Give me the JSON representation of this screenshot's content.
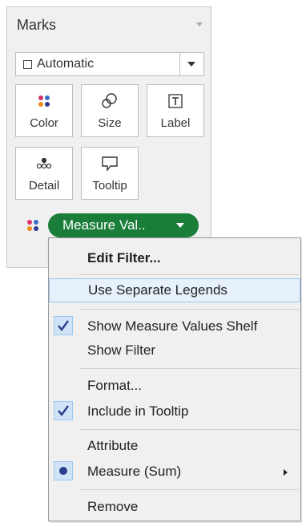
{
  "marks": {
    "title": "Marks",
    "mark_type": "Automatic",
    "tiles": [
      {
        "label": "Color",
        "icon": "color-icon"
      },
      {
        "label": "Size",
        "icon": "size-icon"
      },
      {
        "label": "Label",
        "icon": "label-icon"
      },
      {
        "label": "Detail",
        "icon": "detail-icon"
      },
      {
        "label": "Tooltip",
        "icon": "tooltip-icon"
      }
    ],
    "pill": {
      "label": "Measure Val..",
      "color": "#1a7d3a"
    }
  },
  "menu": {
    "items": [
      {
        "label": "Edit Filter..."
      },
      {
        "label": "Use Separate Legends",
        "highlighted": true
      },
      {
        "label": "Show Measure Values Shelf",
        "checked": true
      },
      {
        "label": "Show Filter"
      },
      {
        "label": "Format..."
      },
      {
        "label": "Include in Tooltip",
        "checked": true
      },
      {
        "label": "Attribute"
      },
      {
        "label": "Measure (Sum)",
        "selected": true,
        "has_submenu": true
      },
      {
        "label": "Remove"
      }
    ]
  },
  "colors": {
    "check_bg": "#cfe4f7",
    "highlight": "#e6f1fb",
    "pill": "#1a7d3a",
    "check_mark": "#2b3f8f"
  }
}
